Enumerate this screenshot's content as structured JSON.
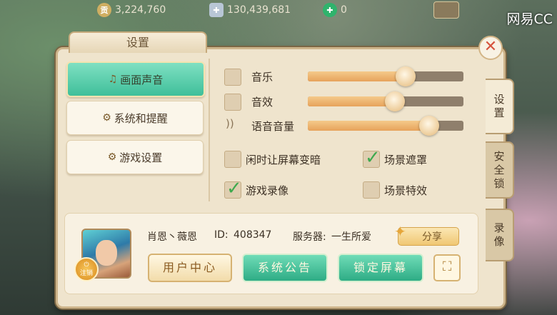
{
  "topbar": {
    "coins_icon": "coin-icon",
    "coins": "3,224,760",
    "silver_icon": "silver-icon",
    "silver": "130,439,681",
    "jade_icon": "jade-icon",
    "jade": "0"
  },
  "watermark": "网易CC",
  "dialog": {
    "title": "设置",
    "close_icon": "close-icon"
  },
  "left_menu": [
    {
      "label": "画面声音",
      "icon": "music-note-icon",
      "active": true
    },
    {
      "label": "系统和提醒",
      "icon": "gears-icon",
      "active": false
    },
    {
      "label": "游戏设置",
      "icon": "gears-icon",
      "active": false
    }
  ],
  "sound": {
    "music_label": "音乐",
    "music_level": 0.63,
    "effects_label": "音效",
    "effects_level": 0.56,
    "voice_label": "语音音量",
    "voice_level": 0.78
  },
  "options": {
    "dim_screen_label": "闲时让屏幕变暗",
    "dim_screen_checked": false,
    "scene_mask_label": "场景遮罩",
    "scene_mask_checked": true,
    "recording_label": "游戏录像",
    "recording_checked": true,
    "scene_effects_label": "场景特效",
    "scene_effects_checked": false
  },
  "side_tabs": [
    {
      "label": "设置",
      "active": true
    },
    {
      "label": "安全锁",
      "active": false
    },
    {
      "label": "录像",
      "active": false
    }
  ],
  "account": {
    "logout_label": "注销",
    "name": "肖恩丶薇恩",
    "id_label": "ID:",
    "id": "408347",
    "server_label": "服务器:",
    "server": "一生所爱",
    "share_label": "分享"
  },
  "buttons": {
    "user_center": "用户中心",
    "announcement": "系统公告",
    "lock_screen": "锁定屏幕"
  },
  "colors": {
    "accent_green": "#3fbf9a",
    "slider_fill": "#e7a35b",
    "panel_bg": "#efe4cd",
    "close_red": "#d6533d"
  }
}
